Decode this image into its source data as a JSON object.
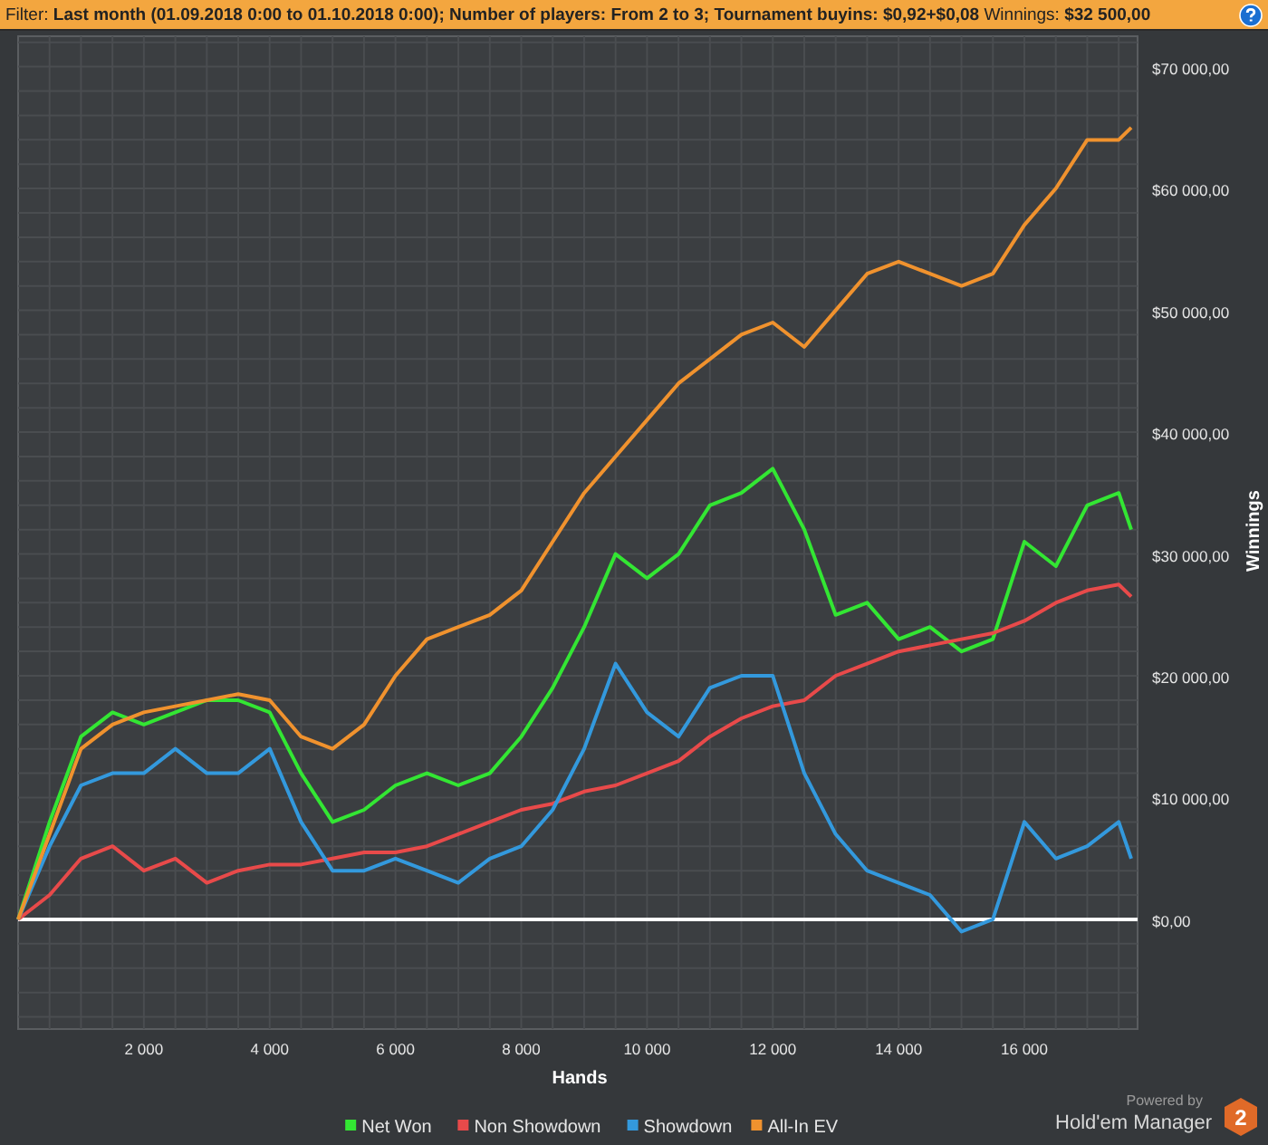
{
  "filter_bar": {
    "text": "Filter: **Last month (01.09.2018 0:00 to 01.10.2018 0:00); Number of players: From 2 to 3; Tournament buyins: $0,92+$0,08** Winnings: **$32 500,00**"
  },
  "chart": {
    "chart_data": {
      "type": "line",
      "xlabel": "Hands",
      "ylabel": "Winnings",
      "x": [
        0,
        500,
        1000,
        1500,
        2000,
        2500,
        3000,
        3500,
        4000,
        4500,
        5000,
        5500,
        6000,
        6500,
        7000,
        7500,
        8000,
        8500,
        9000,
        9500,
        10000,
        10500,
        11000,
        11500,
        12000,
        12500,
        13000,
        13500,
        14000,
        14500,
        15000,
        15500,
        16000,
        16500,
        17000,
        17500,
        17700
      ],
      "series": [
        {
          "name": "Net Won",
          "color": "#33e633",
          "values": [
            0,
            8000,
            15000,
            17000,
            16000,
            17000,
            18000,
            18000,
            17000,
            12000,
            8000,
            9000,
            11000,
            12000,
            11000,
            12000,
            15000,
            19000,
            24000,
            30000,
            28000,
            30000,
            34000,
            35000,
            37000,
            32000,
            25000,
            26000,
            23000,
            24000,
            22000,
            23000,
            31000,
            29000,
            34000,
            35000,
            32000
          ]
        },
        {
          "name": "Non Showdown",
          "color": "#e84a4a",
          "values": [
            0,
            2000,
            5000,
            6000,
            4000,
            5000,
            3000,
            4000,
            4500,
            4500,
            5000,
            5500,
            5500,
            6000,
            7000,
            8000,
            9000,
            9500,
            10500,
            11000,
            12000,
            13000,
            15000,
            16500,
            17500,
            18000,
            20000,
            21000,
            22000,
            22500,
            23000,
            23500,
            24500,
            26000,
            27000,
            27500,
            26500
          ]
        },
        {
          "name": "Showdown",
          "color": "#3399dd",
          "values": [
            0,
            6000,
            11000,
            12000,
            12000,
            14000,
            12000,
            12000,
            14000,
            8000,
            4000,
            4000,
            5000,
            4000,
            3000,
            5000,
            6000,
            9000,
            14000,
            21000,
            17000,
            15000,
            19000,
            20000,
            20000,
            12000,
            7000,
            4000,
            3000,
            2000,
            -1000,
            0,
            8000,
            5000,
            6000,
            8000,
            5000
          ]
        },
        {
          "name": "All-In EV",
          "color": "#f0922e",
          "values": [
            0,
            7000,
            14000,
            16000,
            17000,
            17500,
            18000,
            18500,
            18000,
            15000,
            14000,
            16000,
            20000,
            23000,
            24000,
            25000,
            27000,
            31000,
            35000,
            38000,
            41000,
            44000,
            46000,
            48000,
            49000,
            47000,
            50000,
            53000,
            54000,
            53000,
            52000,
            53000,
            57000,
            60000,
            64000,
            64000,
            65000
          ]
        }
      ],
      "grid": true,
      "legend": "bottom",
      "xlim": [
        0,
        17800
      ],
      "ylim": [
        -9000,
        72500
      ],
      "xticks": [
        {
          "value": 2000,
          "label": "2 000"
        },
        {
          "value": 4000,
          "label": "4 000"
        },
        {
          "value": 6000,
          "label": "6 000"
        },
        {
          "value": 8000,
          "label": "8 000"
        },
        {
          "value": 10000,
          "label": "10 000"
        },
        {
          "value": 12000,
          "label": "12 000"
        },
        {
          "value": 14000,
          "label": "14 000"
        },
        {
          "value": 16000,
          "label": "16 000"
        }
      ],
      "yticks": [
        {
          "value": 0,
          "label": "$0,00"
        },
        {
          "value": 10000,
          "label": "$10 000,00"
        },
        {
          "value": 20000,
          "label": "$20 000,00"
        },
        {
          "value": 30000,
          "label": "$30 000,00"
        },
        {
          "value": 40000,
          "label": "$40 000,00"
        },
        {
          "value": 50000,
          "label": "$50 000,00"
        },
        {
          "value": 60000,
          "label": "$60 000,00"
        },
        {
          "value": 70000,
          "label": "$70 000,00"
        }
      ]
    }
  },
  "branding": {
    "powered_by": "Powered by",
    "product": "Hold'em Manager",
    "version": "2"
  }
}
